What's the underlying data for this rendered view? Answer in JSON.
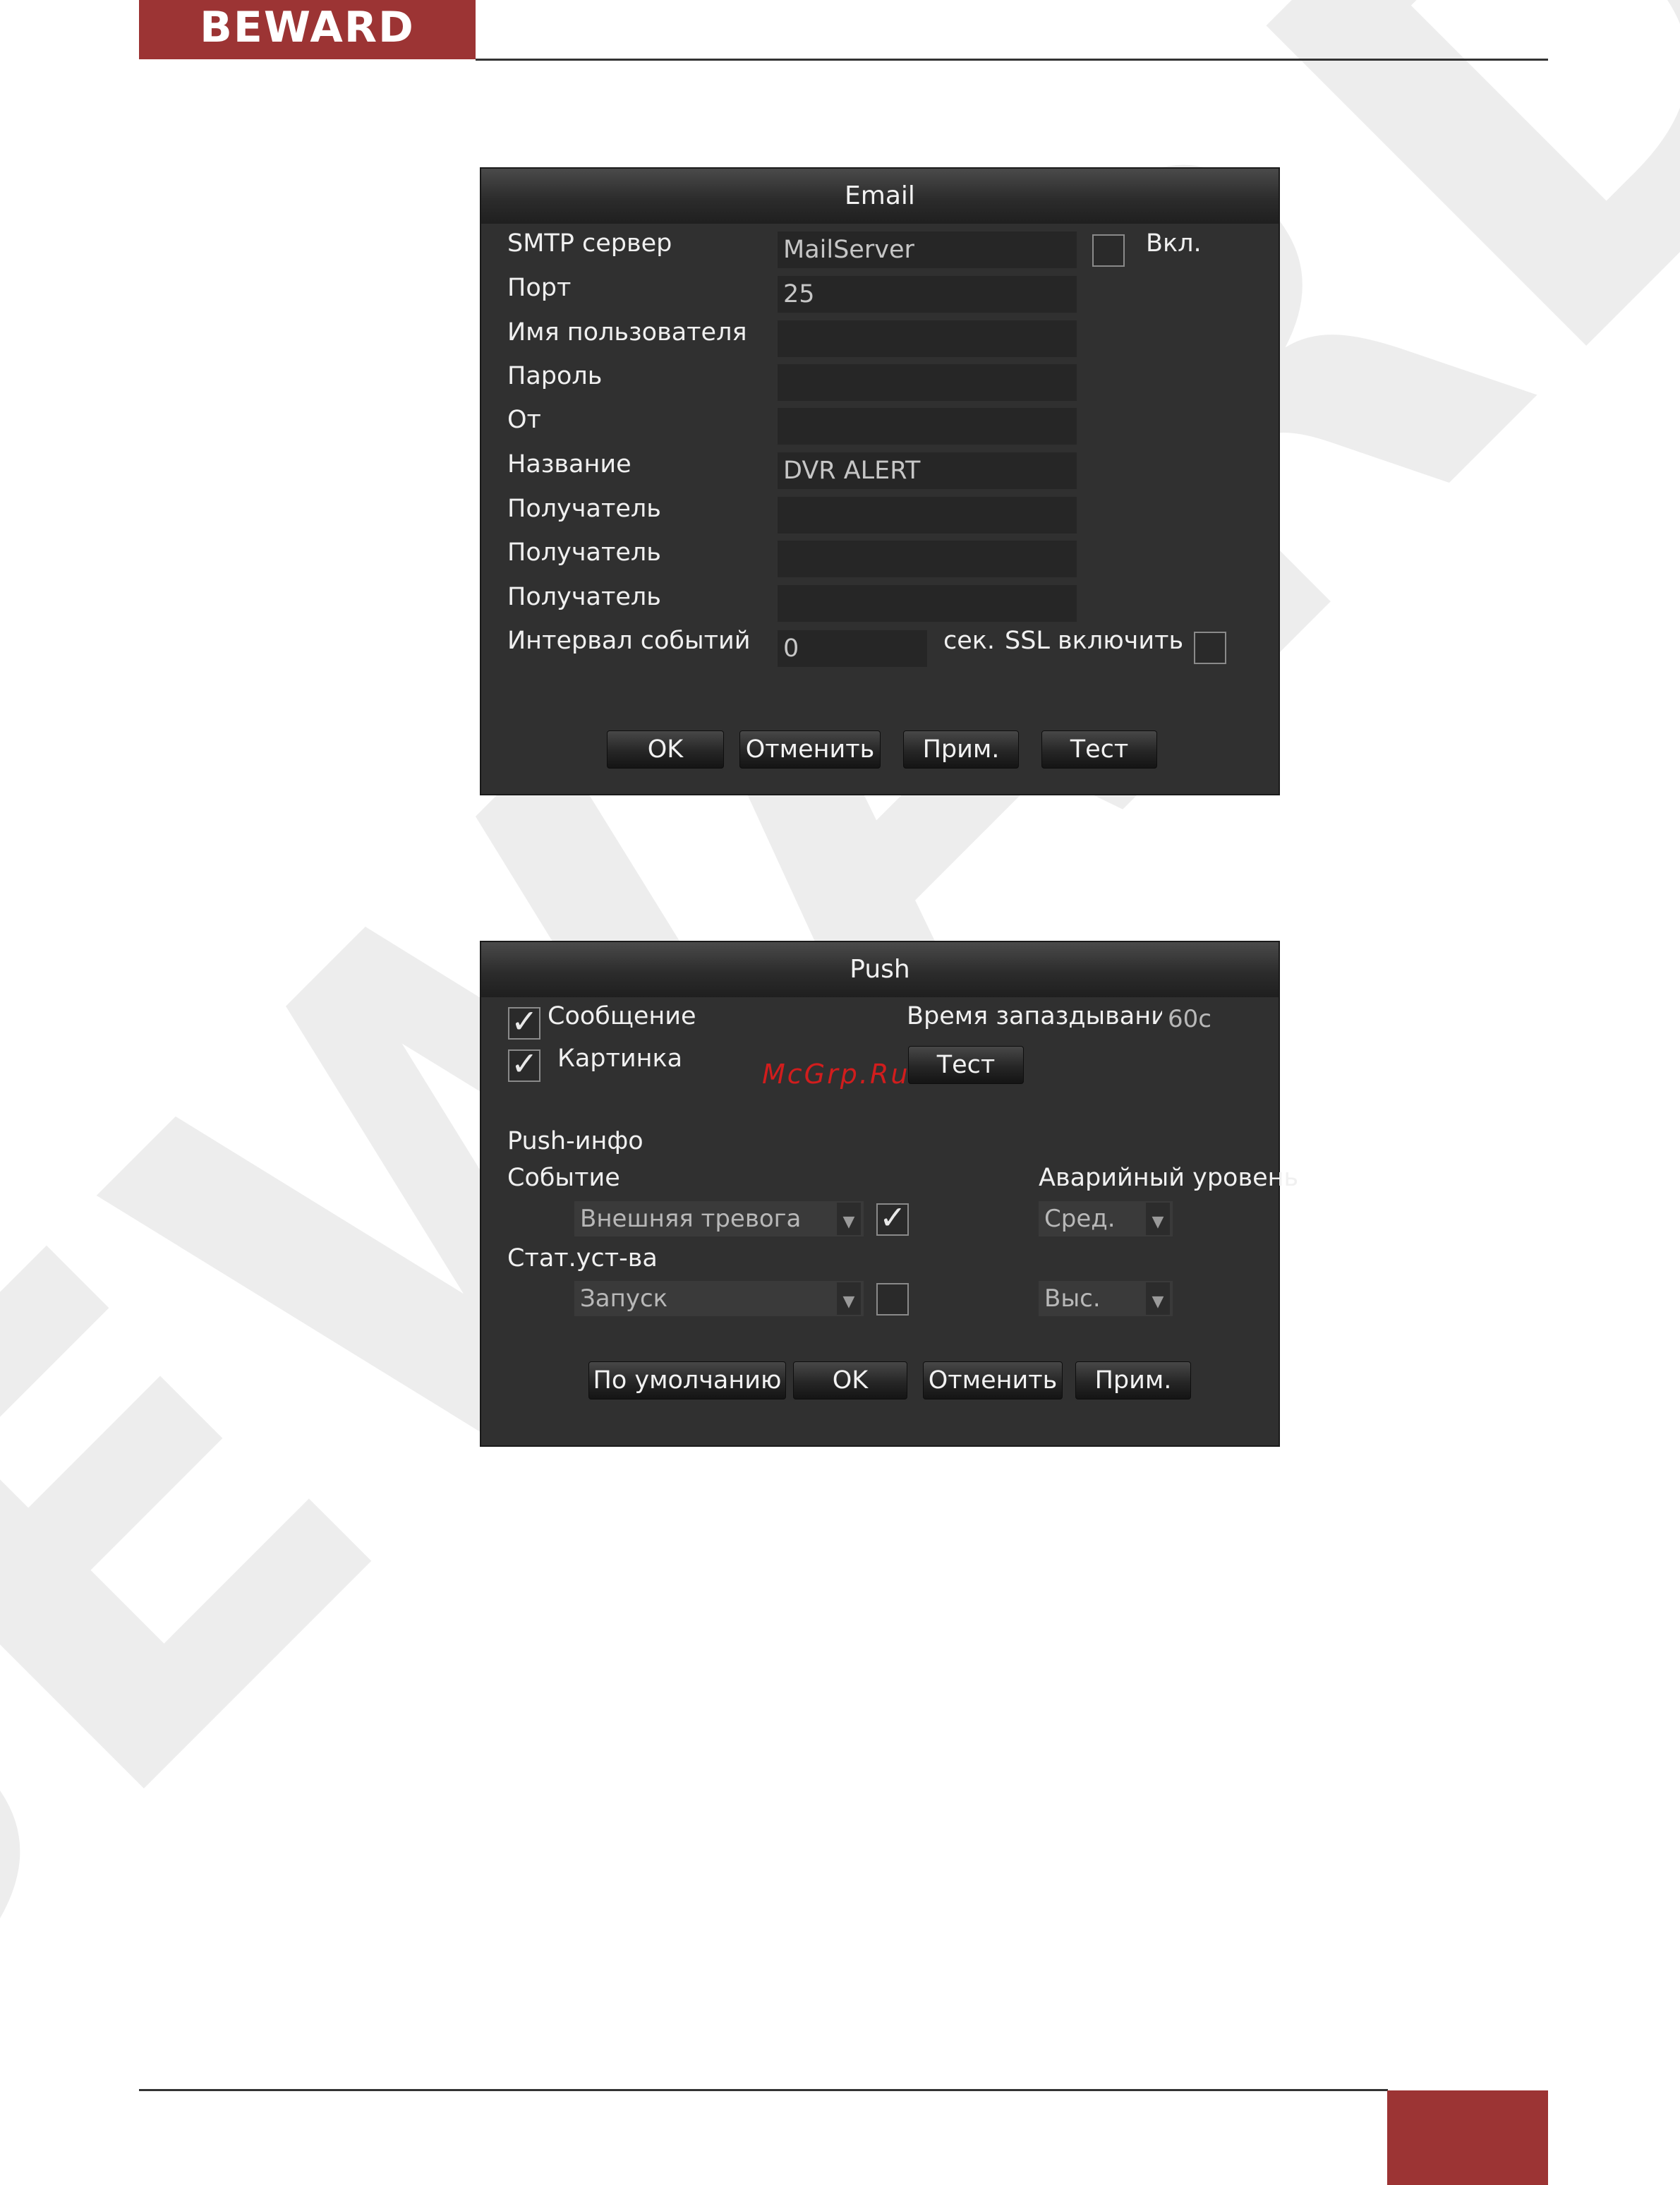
{
  "header": {
    "brand": "BEWARD",
    "brand_color": "#9c3434"
  },
  "watermark": {
    "brand": "BEWARD"
  },
  "email": {
    "title": "Email",
    "fields": [
      {
        "label": "SMTP сервер",
        "value": "MailServer"
      },
      {
        "label": "Порт",
        "value": "25"
      },
      {
        "label": "Имя пользователя",
        "value": ""
      },
      {
        "label": "Пароль",
        "value": ""
      },
      {
        "label": "От",
        "value": ""
      },
      {
        "label": "Название",
        "value": "DVR ALERT"
      },
      {
        "label": "Получатель",
        "value": ""
      },
      {
        "label": "Получатель",
        "value": ""
      },
      {
        "label": "Получатель",
        "value": ""
      }
    ],
    "enable_label": "Вкл.",
    "enable_checked": false,
    "interval_label": "Интервал событий",
    "interval_value": "0",
    "interval_unit": "сек.",
    "ssl_label": "SSL включить",
    "ssl_checked": false,
    "buttons": {
      "ok": "OK",
      "cancel": "Отменить",
      "apply": "Прим.",
      "test": "Тест"
    }
  },
  "push": {
    "title": "Push",
    "message_label": "Сообщение",
    "message_checked": true,
    "picture_label": "Картинка",
    "picture_checked": true,
    "delay_label": "Время запаздывания",
    "delay_value": "60с",
    "test_button": "Тест",
    "info_label": "Push-инфо",
    "event_label": "Событие",
    "event_select": "Внешняя тревога",
    "event_checked": true,
    "alarm_level_label": "Аварийный уровень",
    "event_level": "Сред.",
    "device_state_label": "Стат.уст-ва",
    "device_state_select": "Запуск",
    "device_state_checked": false,
    "device_level": "Выс.",
    "buttons": {
      "default": "По умолчанию",
      "ok": "OK",
      "cancel": "Отменить",
      "apply": "Прим."
    }
  },
  "overlay_text": "McGrp.Ru"
}
